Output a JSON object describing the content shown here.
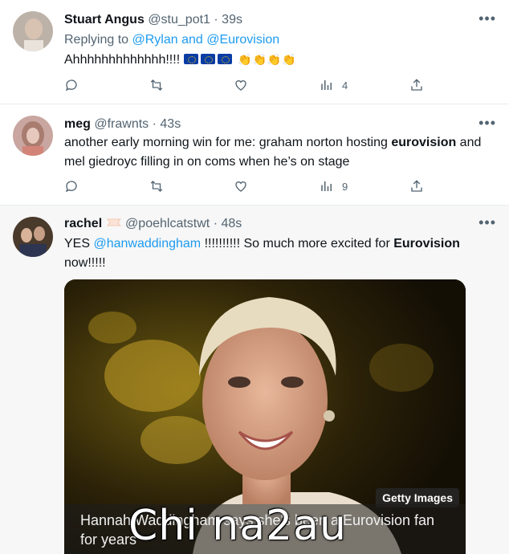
{
  "tweets": [
    {
      "name": "Stuart Angus",
      "handle": "@stu_pot1",
      "separator": "·",
      "time": "39s",
      "reply_prefix": "Replying to ",
      "reply_targets": "@Rylan and @Eurovision",
      "text": "Ahhhhhhhhhhhhh!!!!",
      "emoji": [
        "eu-flag",
        "eu-flag",
        "eu-flag",
        "clapping-hands",
        "clapping-hands",
        "clapping-hands",
        "clapping-hands"
      ],
      "views": "4"
    },
    {
      "name": "meg",
      "handle": "@frawnts",
      "separator": "·",
      "time": "43s",
      "text_1": "another early morning win for me: graham norton hosting ",
      "text_bold": "eurovision",
      "text_2": " and mel giedroyc filling in on coms when he’s on stage",
      "views": "9"
    },
    {
      "name": "rachel",
      "handle": "@poehlcatstwt",
      "separator": "·",
      "time": "48s",
      "text_1": "YES ",
      "mention": "@hanwaddingham",
      "text_2": " !!!!!!!!!! So much more excited for ",
      "text_bold": "Eurovision",
      "text_3": " now!!!!!",
      "media": {
        "credit": "Getty Images",
        "caption": "Hannah Waddingham says she's been a Eurovision fan for years"
      }
    }
  ],
  "watermark": "Chi na2au",
  "colors": {
    "link": "#1d9bf0",
    "muted": "#536471",
    "text": "#0f1419"
  }
}
